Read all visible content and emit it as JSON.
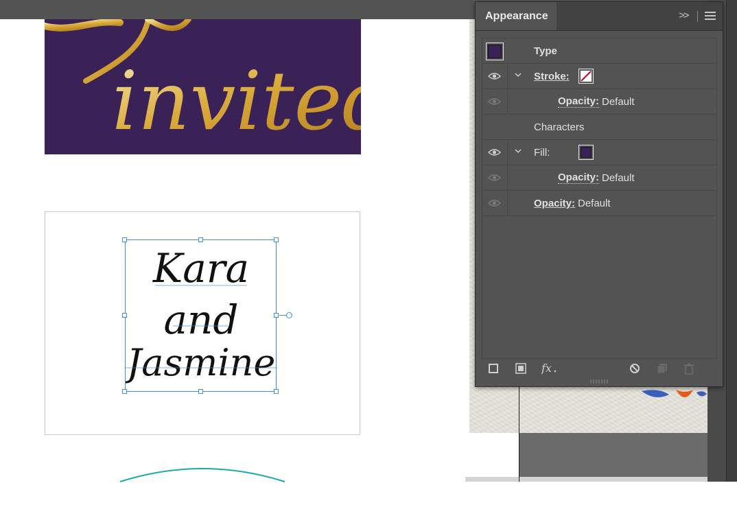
{
  "colors": {
    "invite_bg": "#3a2256",
    "gold": "#d9b24a",
    "selection_blue": "#3b8fd8",
    "panel_bg": "#535353",
    "fill_color": "#3a2256",
    "stroke_none_red": "#d0021b"
  },
  "artwork": {
    "invite_word": "invited",
    "script_lines": [
      "Kara",
      "and",
      "Jasmine"
    ]
  },
  "panel": {
    "title": "Appearance",
    "collapse_icon": "double-chevron-right-icon",
    "menu_icon": "hamburger-menu-icon",
    "rows": [
      {
        "label": "Type"
      },
      {
        "label": "Stroke:"
      },
      {
        "label": "Opacity:",
        "value": "Default"
      },
      {
        "label": "Characters"
      },
      {
        "label": "Fill:"
      },
      {
        "label": "Opacity:",
        "value": "Default"
      },
      {
        "label": "Opacity:",
        "value": "Default"
      }
    ],
    "footer_icons": [
      "add-new-stroke-icon",
      "add-new-fill-icon",
      "fx-icon",
      "clear-appearance-icon",
      "duplicate-item-icon",
      "delete-item-icon"
    ]
  }
}
